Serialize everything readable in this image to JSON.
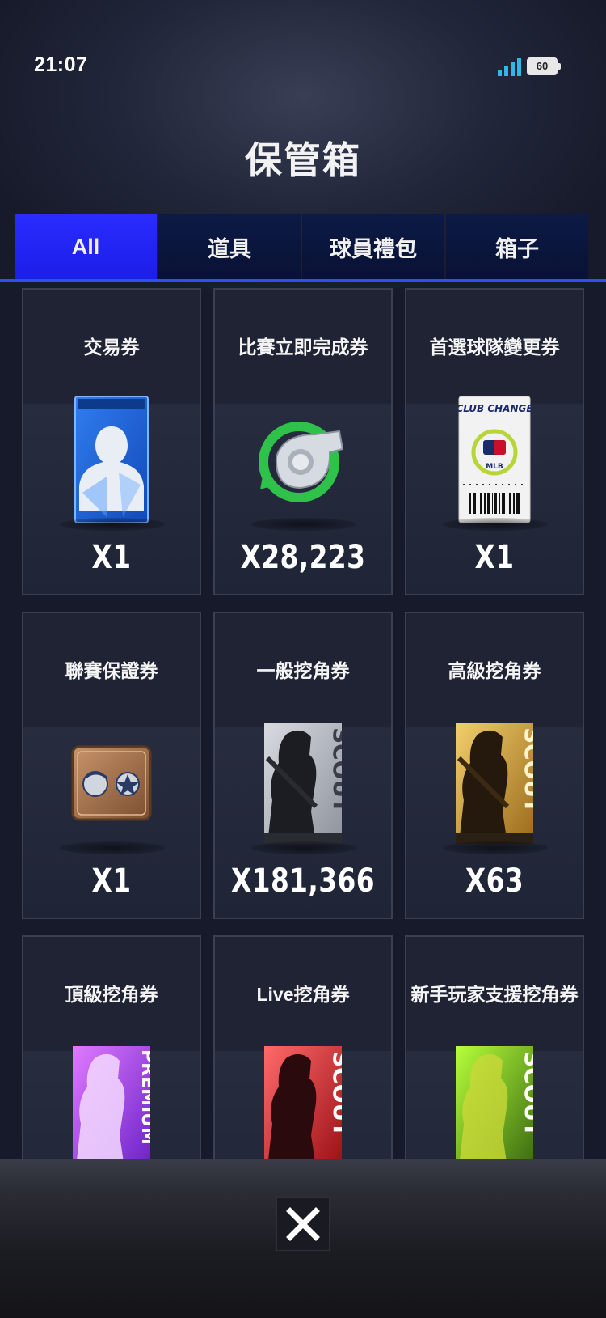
{
  "status_bar": {
    "time": "21:07",
    "battery": "60"
  },
  "header": {
    "title": "保管箱"
  },
  "tabs": [
    {
      "label": "All",
      "active": true
    },
    {
      "label": "道具",
      "active": false
    },
    {
      "label": "球員禮包",
      "active": false
    },
    {
      "label": "箱子",
      "active": false
    }
  ],
  "items": [
    {
      "name": "交易券",
      "count": "X1",
      "icon": "player-card-icon"
    },
    {
      "name": "比賽立即完成券",
      "count": "X28,223",
      "icon": "whistle-icon"
    },
    {
      "name": "首選球隊變更券",
      "count": "X1",
      "icon": "club-change-ticket-icon",
      "art_text": "CLUB CHANGE",
      "art_logo": "MLB"
    },
    {
      "name": "聯賽保證券",
      "count": "X1",
      "icon": "league-badge-icon"
    },
    {
      "name": "一般挖角券",
      "count": "X181,366",
      "icon": "scout-card-silver-icon",
      "art_text": "SCOUT"
    },
    {
      "name": "高級挖角券",
      "count": "X63",
      "icon": "scout-card-gold-icon",
      "art_text": "SCOUT"
    },
    {
      "name": "頂級挖角券",
      "count": "",
      "icon": "scout-card-premium-icon",
      "art_text": "PREMIUM"
    },
    {
      "name": "Live挖角券",
      "count": "",
      "icon": "scout-card-live-icon",
      "art_text": "SCOUT"
    },
    {
      "name": "新手玩家支援挖角券",
      "count": "",
      "icon": "scout-card-rookie-icon",
      "art_text": "SCOUT"
    }
  ],
  "colors": {
    "tab_active": "#2a2cff",
    "tab_inactive": "#0c1a45",
    "accent_line": "#2c52e8"
  }
}
